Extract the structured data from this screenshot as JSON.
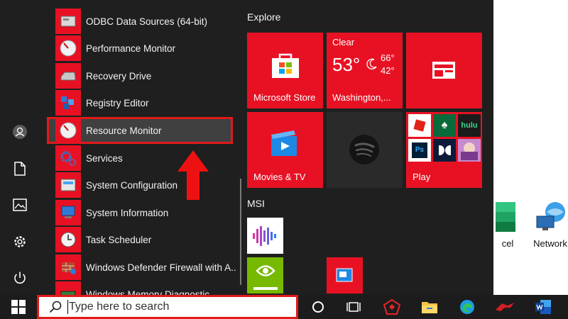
{
  "desktop": {
    "icons": [
      {
        "label": "cel",
        "icon": "excel-icon"
      },
      {
        "label": "Network",
        "icon": "network-icon"
      }
    ]
  },
  "start_menu": {
    "rail": [
      "user-icon",
      "document-icon",
      "pictures-icon",
      "settings-icon",
      "power-icon"
    ],
    "apps": [
      {
        "label": "ODBC Data Sources (64-bit)",
        "icon": "odbc-icon"
      },
      {
        "label": "Performance Monitor",
        "icon": "performance-monitor-icon"
      },
      {
        "label": "Recovery Drive",
        "icon": "recovery-drive-icon"
      },
      {
        "label": "Registry Editor",
        "icon": "registry-editor-icon"
      },
      {
        "label": "Resource Monitor",
        "icon": "resource-monitor-icon",
        "selected": true
      },
      {
        "label": "Services",
        "icon": "services-icon"
      },
      {
        "label": "System Configuration",
        "icon": "system-configuration-icon"
      },
      {
        "label": "System Information",
        "icon": "system-information-icon"
      },
      {
        "label": "Task Scheduler",
        "icon": "task-scheduler-icon"
      },
      {
        "label": "Windows Defender Firewall with A...",
        "icon": "firewall-icon"
      },
      {
        "label": "Windows Memory Diagnostic",
        "icon": "memory-diagnostic-icon"
      }
    ],
    "tiles": {
      "explore_title": "Explore",
      "msi_title": "MSI",
      "store_label": "Microsoft Store",
      "weather": {
        "condition": "Clear",
        "temp": "53°",
        "high": "66°",
        "low": "42°",
        "location": "Washington,..."
      },
      "movies_label": "Movies & TV",
      "play_label": "Play"
    }
  },
  "taskbar": {
    "search_placeholder": "Type here to search"
  },
  "colors": {
    "accent_red": "#e81123",
    "highlight_border": "#e01a1a",
    "start_bg": "#1f1f1f"
  }
}
